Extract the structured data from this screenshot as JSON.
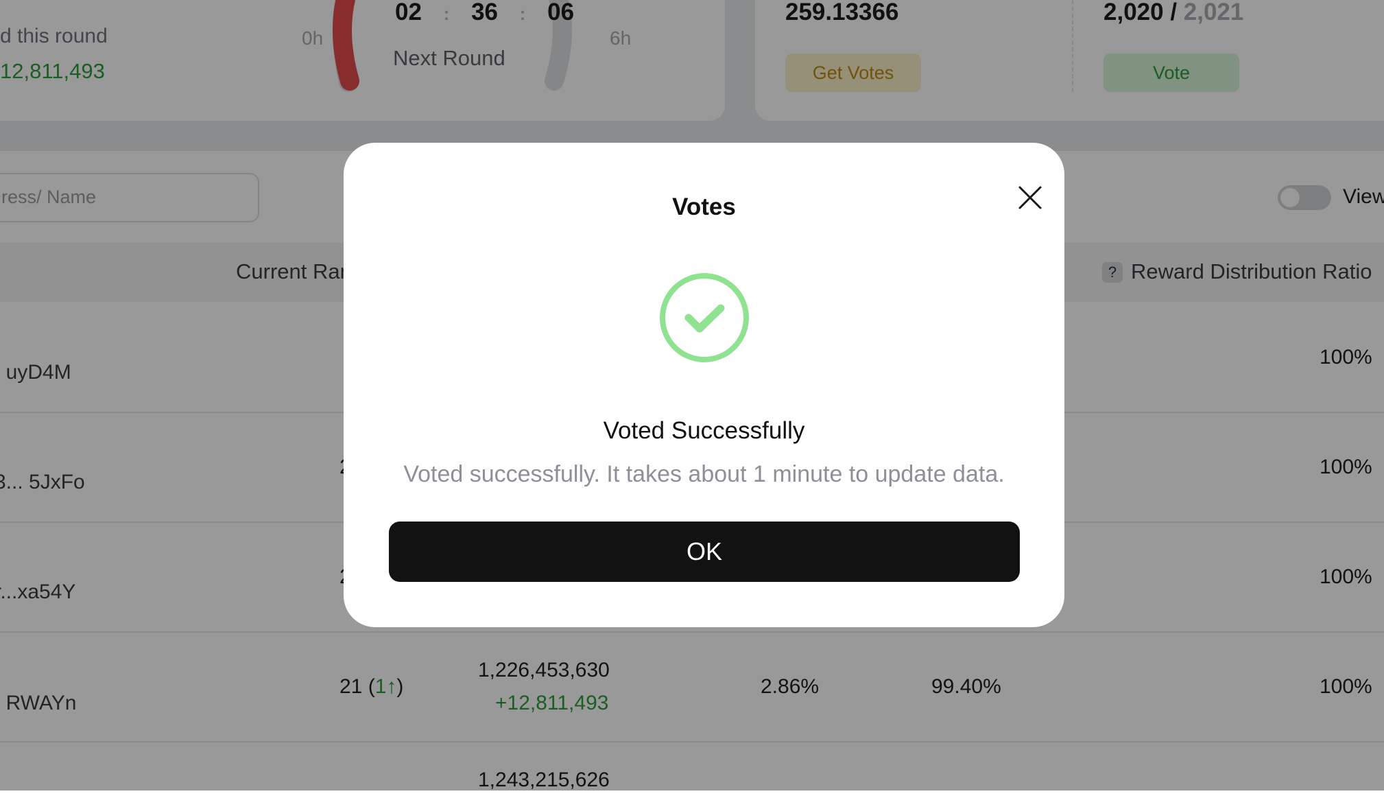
{
  "round": {
    "earned_label": "d this round",
    "earned_value": "12,811,493",
    "timer": {
      "hours": "02",
      "minutes": "36",
      "seconds": "06",
      "sep": ":"
    },
    "next_round_label": "Next Round",
    "start_label": "0h",
    "end_label": "6h"
  },
  "votes_panel": {
    "balance": "259.13366",
    "get_votes_label": "Get Votes",
    "count_used": "2,020",
    "count_sep": " / ",
    "count_total": "2,021",
    "vote_label": "Vote"
  },
  "toolbar": {
    "search_placeholder": "ress/ Name",
    "view_toggle_label": "View"
  },
  "table": {
    "headers": {
      "current_rank": "Current Ran",
      "reward_help_icon": "?",
      "reward_ratio": "Reward Distribution Ratio"
    },
    "rows": [
      {
        "name": ". uyD4M",
        "rank": "",
        "votes": "",
        "votes_change": "",
        "pct1": "",
        "pct2": "",
        "ratio": "100%"
      },
      {
        "name": "3... 5JxFo",
        "rank": "2",
        "votes": "",
        "votes_change": "",
        "pct1": "",
        "pct2": "",
        "ratio": "100%"
      },
      {
        "name": "r...xa54Y",
        "rank": "2",
        "votes": "",
        "votes_change": "",
        "pct1": "",
        "pct2": "",
        "ratio": "100%"
      },
      {
        "name": ". RWAYn",
        "rank_prefix": "21 (",
        "rank_change": "1↑",
        "rank_suffix": ")",
        "votes": "1,226,453,630",
        "votes_change": "+12,811,493",
        "pct1": "2.86%",
        "pct2": "99.40%",
        "ratio": "100%"
      },
      {
        "name": "",
        "rank": "",
        "votes": "1,243,215,626",
        "votes_change": "",
        "pct1": "",
        "pct2": "",
        "ratio": ""
      }
    ]
  },
  "modal": {
    "title": "Votes",
    "close_icon": "close-icon",
    "status_icon": "success-check-icon",
    "heading": "Voted Successfully",
    "message": "Voted successfully. It takes about 1 minute to update data.",
    "ok_label": "OK"
  },
  "colors": {
    "accent_green": "#2e9c3a",
    "success_ring": "#8fe28f",
    "get_votes_bg": "#fbf0c9",
    "get_votes_text": "#b98a17",
    "vote_bg": "#d5f3d5",
    "vote_text": "#2f9a3c",
    "timer_red": "#e14b4b",
    "ok_bg": "#121212"
  }
}
